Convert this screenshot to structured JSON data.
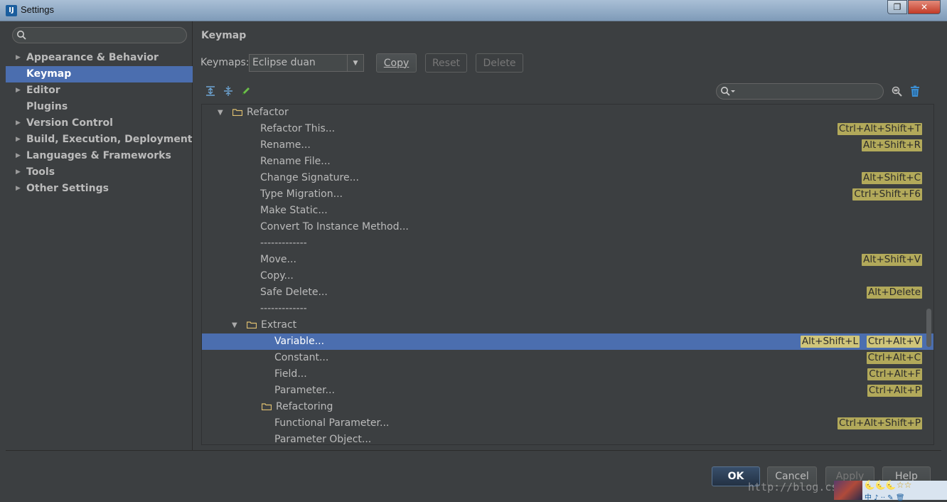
{
  "window": {
    "title": "Settings",
    "app_icon": "intellij-idea-icon",
    "restore_glyph": "❐",
    "close_glyph": "✕"
  },
  "sidebar": {
    "search_placeholder": "",
    "items": [
      {
        "label": "Appearance & Behavior",
        "expandable": true
      },
      {
        "label": "Keymap",
        "expandable": false,
        "selected": true
      },
      {
        "label": "Editor",
        "expandable": true
      },
      {
        "label": "Plugins",
        "expandable": false
      },
      {
        "label": "Version Control",
        "expandable": true
      },
      {
        "label": "Build, Execution, Deployment",
        "expandable": true
      },
      {
        "label": "Languages & Frameworks",
        "expandable": true
      },
      {
        "label": "Tools",
        "expandable": true
      },
      {
        "label": "Other Settings",
        "expandable": true
      }
    ]
  },
  "main": {
    "heading": "Keymap",
    "keymaps_label": "Keymaps:",
    "keymap_selected": "Eclipse duan",
    "buttons": {
      "copy": "Copy",
      "reset": "Reset",
      "delete": "Delete"
    },
    "toolbar_icons": [
      "expand-all-icon",
      "collapse-all-icon",
      "edit-icon"
    ],
    "filter_placeholder": "",
    "right_icons": [
      "find-by-shortcut-icon",
      "clear-filter-icon"
    ]
  },
  "tree": [
    {
      "type": "folder",
      "label": "Refactor",
      "level": 0,
      "expanded": true
    },
    {
      "type": "action",
      "label": "Refactor This...",
      "level": 1,
      "shortcuts": [
        "Ctrl+Alt+Shift+T"
      ]
    },
    {
      "type": "action",
      "label": "Rename...",
      "level": 1,
      "shortcuts": [
        "Alt+Shift+R"
      ]
    },
    {
      "type": "action",
      "label": "Rename File...",
      "level": 1,
      "shortcuts": []
    },
    {
      "type": "action",
      "label": "Change Signature...",
      "level": 1,
      "shortcuts": [
        "Alt+Shift+C"
      ]
    },
    {
      "type": "action",
      "label": "Type Migration...",
      "level": 1,
      "shortcuts": [
        "Ctrl+Shift+F6"
      ]
    },
    {
      "type": "action",
      "label": "Make Static...",
      "level": 1,
      "shortcuts": []
    },
    {
      "type": "action",
      "label": "Convert To Instance Method...",
      "level": 1,
      "shortcuts": []
    },
    {
      "type": "separator",
      "label": "-------------",
      "level": 1,
      "shortcuts": []
    },
    {
      "type": "action",
      "label": "Move...",
      "level": 1,
      "shortcuts": [
        "Alt+Shift+V"
      ]
    },
    {
      "type": "action",
      "label": "Copy...",
      "level": 1,
      "shortcuts": []
    },
    {
      "type": "action",
      "label": "Safe Delete...",
      "level": 1,
      "shortcuts": [
        "Alt+Delete"
      ]
    },
    {
      "type": "separator",
      "label": "-------------",
      "level": 1,
      "shortcuts": []
    },
    {
      "type": "folder",
      "label": "Extract",
      "level": 1,
      "expanded": true
    },
    {
      "type": "action",
      "label": "Variable...",
      "level": 2,
      "shortcuts": [
        "Alt+Shift+L",
        "Ctrl+Alt+V"
      ],
      "selected": true
    },
    {
      "type": "action",
      "label": "Constant...",
      "level": 2,
      "shortcuts": [
        "Ctrl+Alt+C"
      ]
    },
    {
      "type": "action",
      "label": "Field...",
      "level": 2,
      "shortcuts": [
        "Ctrl+Alt+F"
      ]
    },
    {
      "type": "action",
      "label": "Parameter...",
      "level": 2,
      "shortcuts": [
        "Ctrl+Alt+P"
      ]
    },
    {
      "type": "folder",
      "label": "Refactoring",
      "level": 2,
      "expanded": false,
      "no_arrow": true
    },
    {
      "type": "action",
      "label": "Functional Parameter...",
      "level": 2,
      "shortcuts": [
        "Ctrl+Alt+Shift+P"
      ]
    },
    {
      "type": "action",
      "label": "Parameter Object...",
      "level": 2,
      "shortcuts": []
    }
  ],
  "dialog_buttons": {
    "ok": "OK",
    "cancel": "Cancel",
    "apply": "Apply",
    "help": "Help"
  },
  "overlay": {
    "watermark": "http://blog.csdn.net/dmz Mr",
    "tray_top": "🌜🌜🌜☆☆",
    "tray_bottom": "中 ♪ ·· ✎ 🗑"
  },
  "colors": {
    "selection": "#4b6eaf",
    "shortcut_badge": "#b2a95a",
    "background": "#3c3f41",
    "folder": "#e0c071"
  }
}
